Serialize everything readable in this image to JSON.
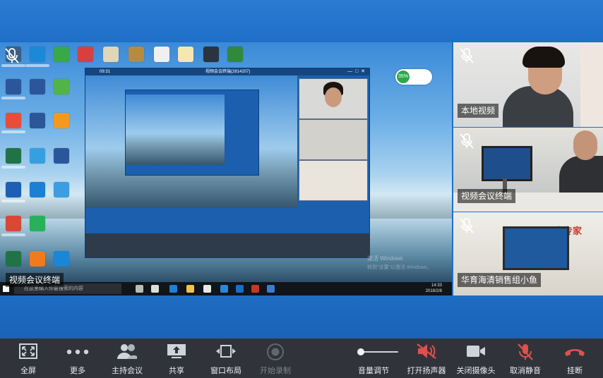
{
  "main_video": {
    "label": "视频会议终端",
    "nested_window_title": "视频会议终端(2814207)",
    "nested_status_time": "09:31",
    "nested_toolbar_labels": [
      "全屏",
      "更多",
      "主持会议",
      "共享",
      "窗口布局",
      "开始录制",
      "音量调节",
      "打开扬声器",
      "关闭摄像头",
      "取消静音",
      "挂断"
    ],
    "inner_thumb_labels": [
      "本地视频",
      "视频会议终端",
      "华育海清销售组小鱼"
    ],
    "taskbar_search": "在这里输入你要搜索的内容",
    "taskbar_time": "14:33",
    "taskbar_date": "2018/2/8",
    "watermark_title": "激活 Windows",
    "watermark_sub": "转到\"设置\"以激活 Windows。",
    "desktop_icon_labels": [
      "",
      "",
      "",
      "",
      "",
      "",
      "",
      "",
      ""
    ],
    "perf_badge": "35%"
  },
  "participants": [
    {
      "name": "本地视频",
      "muted": true
    },
    {
      "name": "视频会议终端",
      "muted": true
    },
    {
      "name": "华育海清销售组小鱼",
      "muted": true
    }
  ],
  "tile3_sign_text": "万案专家",
  "controls": [
    {
      "id": "fullscreen",
      "label": "全屏",
      "icon": "fullscreen-icon",
      "enabled": true
    },
    {
      "id": "more",
      "label": "更多",
      "icon": "more-icon",
      "enabled": true
    },
    {
      "id": "host",
      "label": "主持会议",
      "icon": "host-icon",
      "enabled": true
    },
    {
      "id": "share",
      "label": "共享",
      "icon": "share-icon",
      "enabled": true
    },
    {
      "id": "layout",
      "label": "窗口布局",
      "icon": "layout-icon",
      "enabled": true
    },
    {
      "id": "record",
      "label": "开始录制",
      "icon": "record-icon",
      "enabled": false
    },
    {
      "id": "volume",
      "label": "音量调节",
      "icon": "volume-slider-icon",
      "enabled": true
    },
    {
      "id": "speaker",
      "label": "打开扬声器",
      "icon": "speaker-muted-icon",
      "enabled": true
    },
    {
      "id": "camera",
      "label": "关闭摄像头",
      "icon": "camera-icon",
      "enabled": true
    },
    {
      "id": "unmute",
      "label": "取消静音",
      "icon": "mic-muted-icon",
      "enabled": true
    },
    {
      "id": "hangup",
      "label": "挂断",
      "icon": "hangup-icon",
      "enabled": true
    }
  ],
  "volume_level": 0.05,
  "colors": {
    "hangup": "#e0504d",
    "speaker_muted": "#e0504d",
    "mic_muted": "#e0504d",
    "bar_bg": "#30343a",
    "accent_blue": "#1f6fc8"
  }
}
